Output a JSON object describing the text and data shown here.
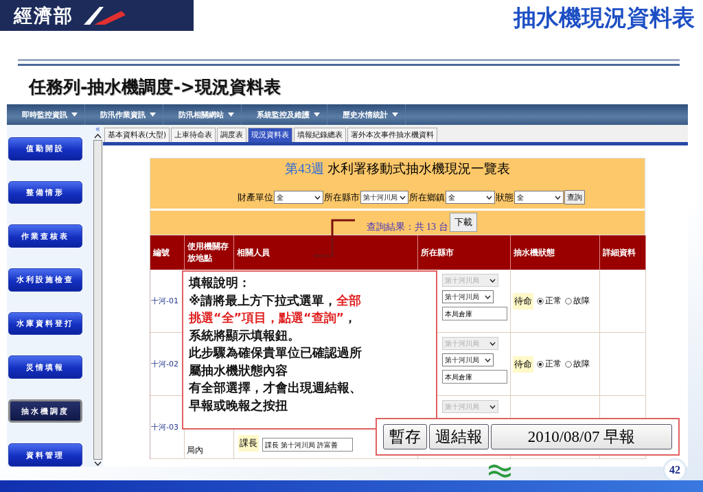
{
  "header": {
    "logo": "經濟部",
    "title": "抽水機現況資料表"
  },
  "subtitle": "任務列-抽水機調度->現況資料表",
  "menu": [
    {
      "label": "即時監控資訊"
    },
    {
      "label": "防汛作業資訊"
    },
    {
      "label": "防汛相關網站"
    },
    {
      "label": "系統監控及維護"
    },
    {
      "label": "歷史水情統計"
    }
  ],
  "sidebar": [
    {
      "label": "值勤開設",
      "selected": false
    },
    {
      "label": "整備情形",
      "selected": false
    },
    {
      "label": "作業查核表",
      "selected": false
    },
    {
      "label": "水利設施檢查",
      "selected": false
    },
    {
      "label": "水庫資料登打",
      "selected": false
    },
    {
      "label": "災情填報",
      "selected": false
    },
    {
      "label": "抽水機調度",
      "selected": true
    },
    {
      "label": "資料管理",
      "selected": false
    }
  ],
  "collapse": "«",
  "tabs": [
    {
      "label": "基本資料表(大型)",
      "selected": false
    },
    {
      "label": "上車待命表",
      "selected": false
    },
    {
      "label": "調度表",
      "selected": false
    },
    {
      "label": "現況資料表",
      "selected": true
    },
    {
      "label": "填報紀錄總表",
      "selected": false
    },
    {
      "label": "署外本次事件抽水機資料",
      "selected": false
    }
  ],
  "report": {
    "week": "第43週",
    "title": "水利署移動式抽水機現況一覽表",
    "filters": [
      {
        "label": "財產單位",
        "value": "全"
      },
      {
        "label": "所在縣市",
        "value": "第十河川局"
      },
      {
        "label": "所在鄉鎮",
        "value": "全"
      },
      {
        "label": "狀態",
        "value": "全"
      }
    ],
    "query_button": "查詢",
    "result": "查詢結果：共 13 台",
    "download_button": "下載"
  },
  "table": {
    "columns": [
      "編號",
      "使用機關存放地點",
      "相關人員",
      "所在縣市",
      "抽水機狀態",
      "詳細資料"
    ],
    "rows": [
      {
        "id": "十河-01",
        "county_locked": "第十河川局",
        "county": "第十河川局",
        "place": "本局倉庫",
        "status": "待命",
        "options": [
          {
            "label": "正常",
            "selected": true
          },
          {
            "label": "故障",
            "selected": false
          }
        ]
      },
      {
        "id": "十河-02",
        "county_locked": "第十河川局",
        "county": "第十河川局",
        "place": "本局倉庫",
        "status": "待命",
        "options": [
          {
            "label": "正常",
            "selected": true
          },
          {
            "label": "故障",
            "selected": false
          }
        ]
      },
      {
        "id": "十河-03",
        "location": "局內",
        "role": "課長",
        "person": "課長 第十河川局 許富善",
        "county_locked": "第十河川局"
      }
    ]
  },
  "callout": {
    "lines": [
      [
        {
          "text": "填報說明：",
          "highlight": false
        }
      ],
      [
        {
          "text": "※請將最上方下拉式選單，",
          "highlight": false
        },
        {
          "text": "全部",
          "highlight": true
        }
      ],
      [
        {
          "text": "挑選“全”項目，點選“查詢”",
          "highlight": true
        },
        {
          "text": "，",
          "highlight": false
        }
      ],
      [
        {
          "text": "系統將顯示填報鈕。",
          "highlight": false
        }
      ],
      [
        {
          "text": "此步驟為確保貴單位已確認過所",
          "highlight": false
        }
      ],
      [
        {
          "text": "屬抽水機狀態內容",
          "highlight": false
        }
      ],
      [
        {
          "text": "有全部選擇，才會出現週結報、",
          "highlight": false
        }
      ],
      [
        {
          "text": "早報或晚報之按扭",
          "highlight": false
        }
      ]
    ]
  },
  "actions": [
    "暫存",
    "週結報",
    "2010/08/07 早報"
  ],
  "page_number": "42"
}
